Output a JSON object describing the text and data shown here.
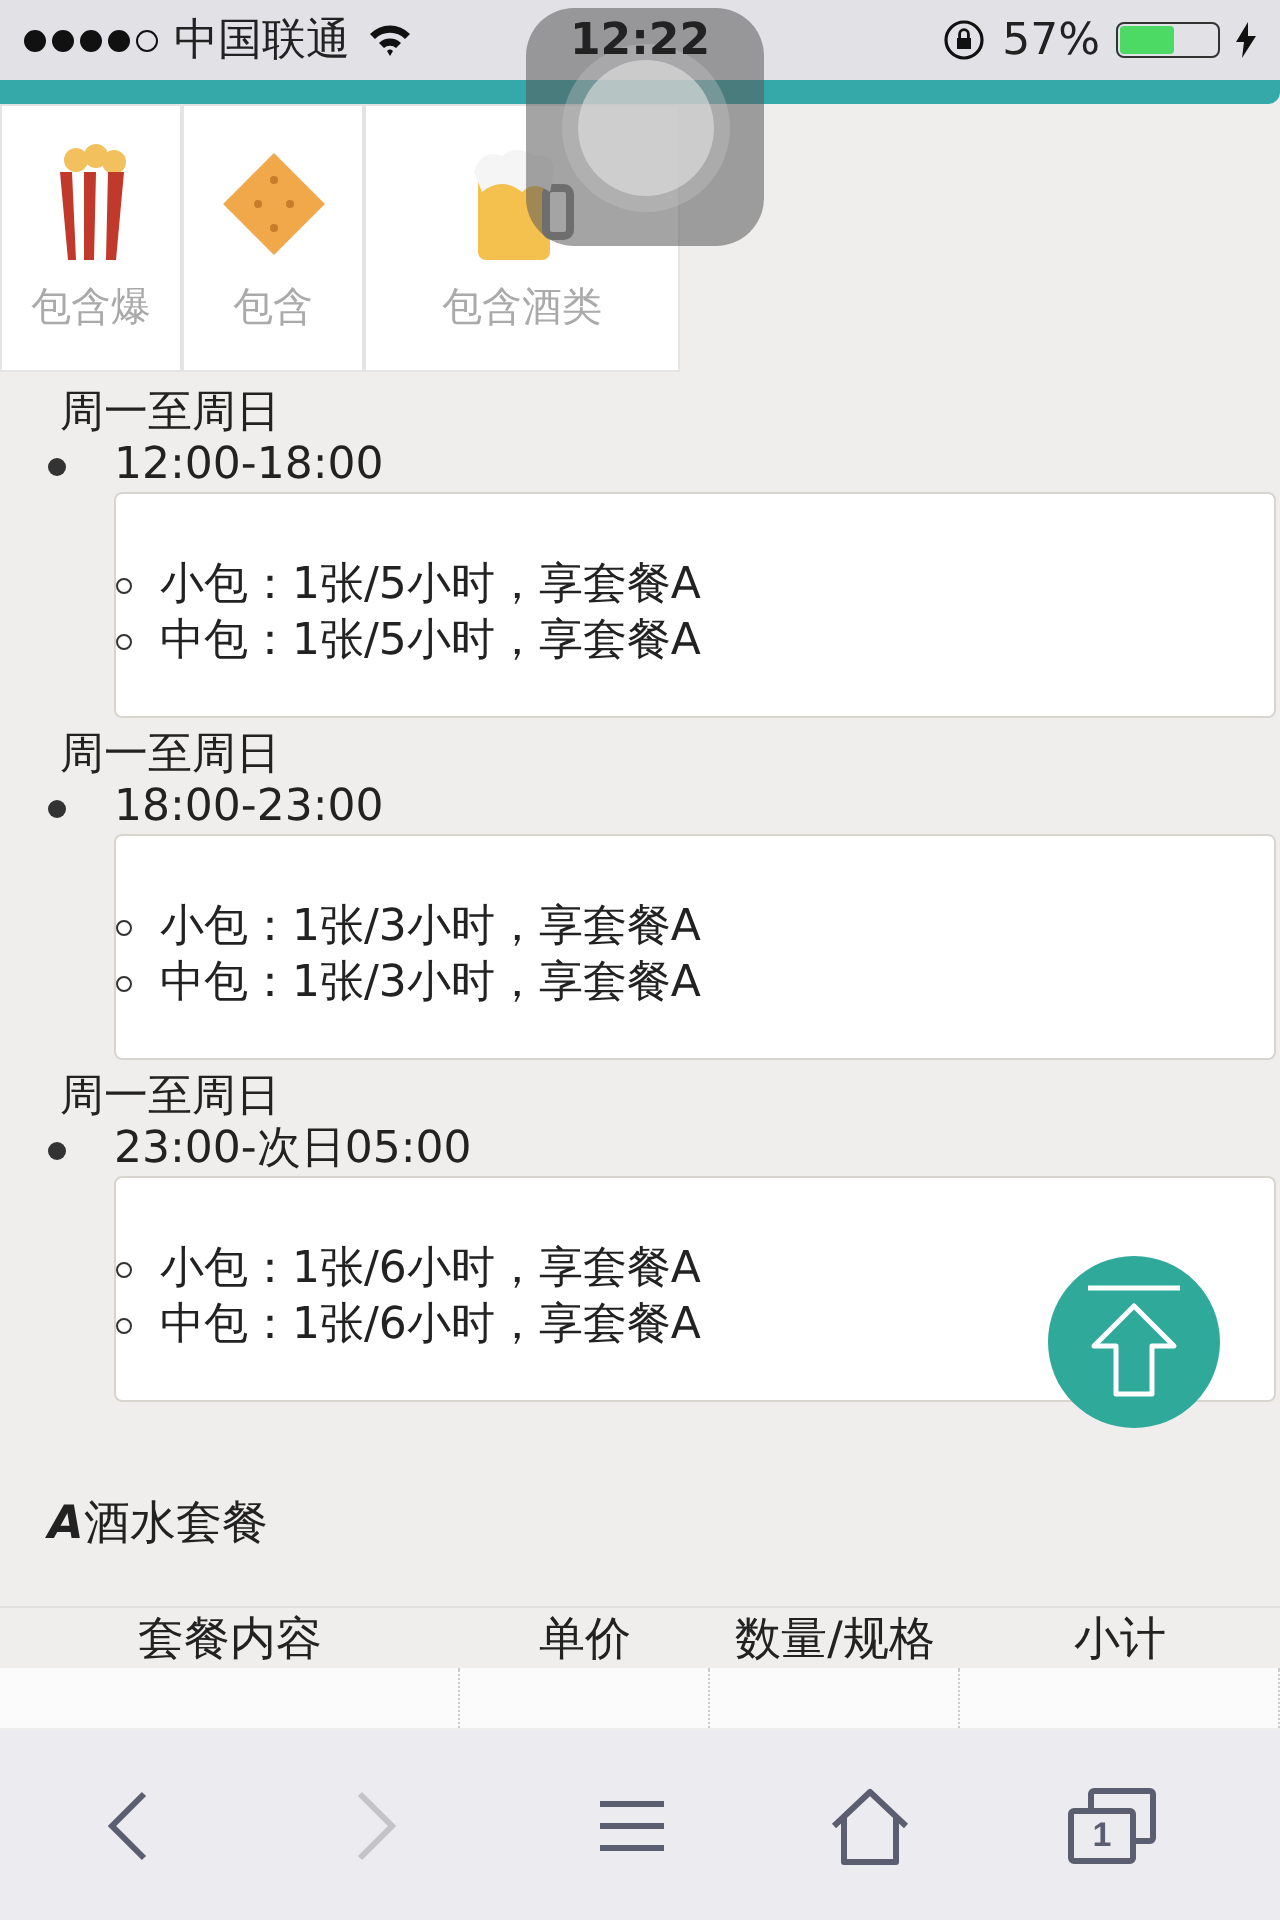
{
  "status_bar": {
    "carrier": "中国联通",
    "time": "12:22",
    "battery": "57%"
  },
  "features": [
    {
      "label": "包含爆",
      "kind": "popcorn"
    },
    {
      "label": "包含",
      "kind": "cracker"
    },
    {
      "label": "包含酒类",
      "kind": "beer"
    }
  ],
  "schedules": [
    {
      "days": "周一至周日",
      "time": "12:00-18:00",
      "rooms": [
        "小包：1张/5小时，享套餐A",
        "中包：1张/5小时，享套餐A"
      ]
    },
    {
      "days": "周一至周日",
      "time": "18:00-23:00",
      "rooms": [
        "小包：1张/3小时，享套餐A",
        "中包：1张/3小时，享套餐A"
      ]
    },
    {
      "days": "周一至周日",
      "time": "23:00-次日05:00",
      "rooms": [
        "小包：1张/6小时，享套餐A",
        "中包：1张/6小时，享套餐A"
      ]
    }
  ],
  "package_title": "**A**酒水套餐",
  "table": {
    "columns": [
      "套餐内容",
      "单价",
      "数量/规格",
      "小计"
    ]
  },
  "toolbar": [
    {
      "kind": "back",
      "disabled": false
    },
    {
      "kind": "forward",
      "disabled": true
    },
    {
      "kind": "menu",
      "disabled": false
    },
    {
      "kind": "home",
      "disabled": false
    },
    {
      "kind": "tabs",
      "disabled": false,
      "count": "1"
    }
  ]
}
